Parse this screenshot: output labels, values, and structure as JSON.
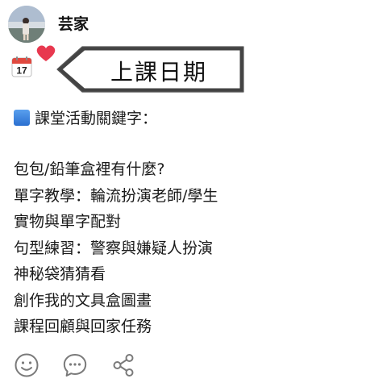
{
  "post": {
    "author": {
      "name": "芸家",
      "avatar_icon": "avatar-photo-icon"
    },
    "date_tag": {
      "icon": "calendar-icon",
      "calendar_label": "17",
      "label": "上課日期",
      "decoration_icon": "heart-icon"
    },
    "section": {
      "bullet_icon": "blue-square-icon",
      "heading": "課堂活動關鍵字："
    },
    "activities": [
      "包包/鉛筆盒裡有什麼?",
      "單字教學：輪流扮演老師/學生",
      "實物與單字配對",
      "句型練習：警察與嫌疑人扮演",
      "神秘袋猜猜看",
      "創作我的文具盒圖畫",
      "課程回顧與回家任務"
    ]
  },
  "actions": [
    {
      "name": "like",
      "icon": "smiley-icon"
    },
    {
      "name": "comment",
      "icon": "chat-bubble-icon"
    },
    {
      "name": "share",
      "icon": "share-icon"
    }
  ],
  "colors": {
    "heart": "#e8384f",
    "bullet_blue": "#2a6fd0",
    "action_icons": "#7a7a7a",
    "calendar_red": "#e0483e"
  }
}
